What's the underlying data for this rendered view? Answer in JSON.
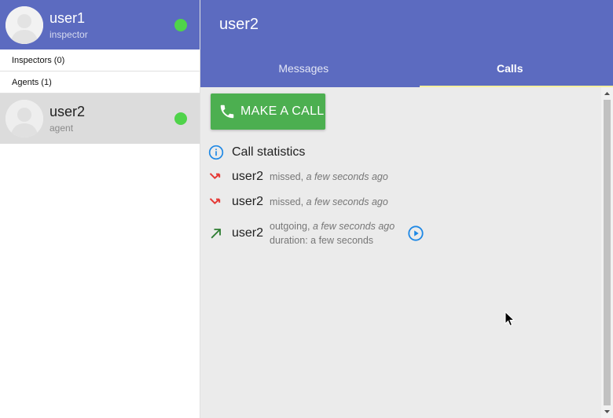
{
  "current_user": {
    "name": "user1",
    "role": "inspector",
    "status_color": "#4fd34a"
  },
  "sidebar": {
    "groups": [
      {
        "label": "Inspectors (0)"
      },
      {
        "label": "Agents (1)"
      }
    ],
    "contacts": [
      {
        "name": "user2",
        "role": "agent",
        "status_color": "#4fd34a"
      }
    ]
  },
  "main": {
    "title": "user2",
    "tabs": [
      {
        "label": "Messages",
        "active": false
      },
      {
        "label": "Calls",
        "active": true
      }
    ],
    "call_button_label": "MAKE A CALL",
    "stats_label": "Call statistics",
    "calls": [
      {
        "name": "user2",
        "type": "missed,",
        "when": "a few seconds ago",
        "icon": "missed-call-icon"
      },
      {
        "name": "user2",
        "type": "missed,",
        "when": "a few seconds ago",
        "icon": "missed-call-icon"
      },
      {
        "name": "user2",
        "type": "outgoing,",
        "when": "a few seconds ago",
        "duration": "duration: a few seconds",
        "icon": "outgoing-call-icon"
      }
    ]
  },
  "colors": {
    "header": "#5c6bc0",
    "call_button": "#4caf50",
    "missed": "#e53935",
    "outgoing": "#2e7d32",
    "info": "#1e88e5"
  }
}
